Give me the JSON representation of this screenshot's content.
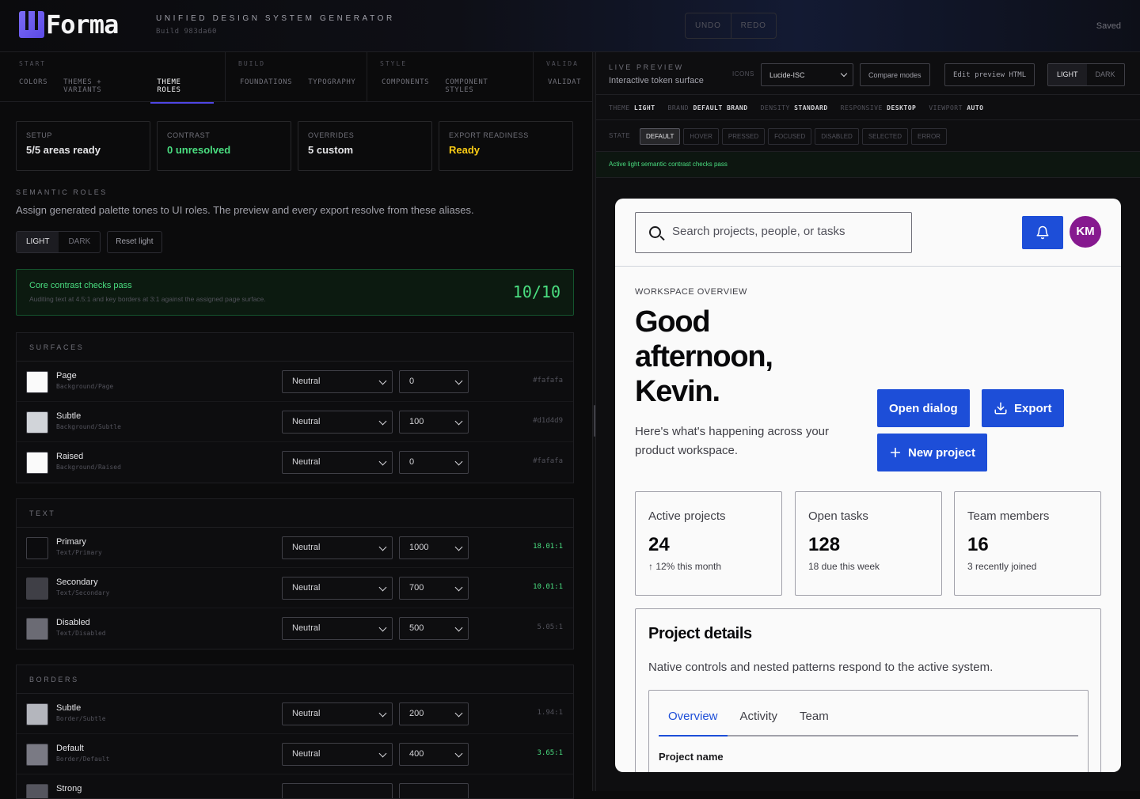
{
  "app": {
    "logo_text": "Forma",
    "subtitle": "UNIFIED DESIGN SYSTEM GENERATOR",
    "build": "Build 983da60",
    "undo": "UNDO",
    "redo": "REDO",
    "saved": "Saved"
  },
  "nav": {
    "groups": [
      {
        "label": "START",
        "items": [
          "COLORS",
          "THEMES + VARIANTS",
          "THEME ROLES"
        ]
      },
      {
        "label": "BUILD",
        "items": [
          "FOUNDATIONS",
          "TYPOGRAPHY"
        ]
      },
      {
        "label": "STYLE",
        "items": [
          "COMPONENTS",
          "COMPONENT STYLES"
        ]
      },
      {
        "label": "VALIDA",
        "items": [
          "VALIDAT"
        ]
      }
    ],
    "active": "THEME ROLES"
  },
  "stats": [
    {
      "label": "SETUP",
      "value": "5/5 areas ready"
    },
    {
      "label": "CONTRAST",
      "value": "0 unresolved"
    },
    {
      "label": "OVERRIDES",
      "value": "5 custom"
    },
    {
      "label": "EXPORT READINESS",
      "value": "Ready"
    }
  ],
  "semantic": {
    "heading": "SEMANTIC ROLES",
    "description": "Assign generated palette tones to UI roles. The preview and every export resolve from these aliases.",
    "mode_light": "LIGHT",
    "mode_dark": "DARK",
    "reset": "Reset light"
  },
  "checks": {
    "title": "Core contrast checks pass",
    "desc": "Auditing text at 4.5:1 and key borders at 3:1 against the assigned page surface.",
    "score": "10/10"
  },
  "groups": {
    "surfaces": {
      "title": "SURFACES",
      "rows": [
        {
          "name": "Page",
          "alias": "Background/Page",
          "palette": "Neutral",
          "tone": "0",
          "value": "#fafafa",
          "swatch": "#fafafa"
        },
        {
          "name": "Subtle",
          "alias": "Background/Subtle",
          "palette": "Neutral",
          "tone": "100",
          "value": "#d1d4d9",
          "swatch": "#d1d4d9"
        },
        {
          "name": "Raised",
          "alias": "Background/Raised",
          "palette": "Neutral",
          "tone": "0",
          "value": "#fafafa",
          "swatch": "#fafafa"
        }
      ]
    },
    "text": {
      "title": "TEXT",
      "rows": [
        {
          "name": "Primary",
          "alias": "Text/Primary",
          "palette": "Neutral",
          "tone": "1000",
          "value": "18.01:1",
          "swatch": "#0c0c0e"
        },
        {
          "name": "Secondary",
          "alias": "Text/Secondary",
          "palette": "Neutral",
          "tone": "700",
          "value": "10.01:1",
          "swatch": "#3f3f46"
        },
        {
          "name": "Disabled",
          "alias": "Text/Disabled",
          "palette": "Neutral",
          "tone": "500",
          "value": "5.05:1",
          "swatch": "#6b6b74"
        }
      ]
    },
    "borders": {
      "title": "BORDERS",
      "rows": [
        {
          "name": "Subtle",
          "alias": "Border/Subtle",
          "palette": "Neutral",
          "tone": "200",
          "value": "1.94:1",
          "swatch": "#b4b6bd"
        },
        {
          "name": "Default",
          "alias": "Border/Default",
          "palette": "Neutral",
          "tone": "400",
          "value": "3.65:1",
          "swatch": "#7a7a84"
        },
        {
          "name": "Strong",
          "alias": "",
          "palette": "",
          "tone": "",
          "value": "",
          "swatch": "#55555e"
        }
      ]
    }
  },
  "preview": {
    "heading": "LIVE PREVIEW",
    "subheading": "Interactive token surface",
    "icons_label": "ICONS",
    "icons_value": "Lucide-ISC",
    "compare": "Compare modes",
    "edit_html": "Edit preview HTML",
    "light": "LIGHT",
    "dark": "DARK",
    "meta": [
      {
        "k": "THEME",
        "v": "LIGHT"
      },
      {
        "k": "BRAND",
        "v": "DEFAULT BRAND"
      },
      {
        "k": "DENSITY",
        "v": "STANDARD"
      },
      {
        "k": "RESPONSIVE",
        "v": "DESKTOP"
      },
      {
        "k": "VIEWPORT",
        "v": "AUTO"
      }
    ],
    "state_label": "STATE",
    "states": [
      "DEFAULT",
      "HOVER",
      "PRESSED",
      "FOCUSED",
      "DISABLED",
      "SELECTED",
      "ERROR"
    ],
    "active_msg": "Active light semantic contrast checks pass"
  },
  "card": {
    "search_placeholder": "Search projects, people, or tasks",
    "avatar": "KM",
    "eyebrow": "WORKSPACE OVERVIEW",
    "greeting": "Good afternoon, Kevin.",
    "lead": "Here's what's happening across your product workspace.",
    "btn_dialog": "Open dialog",
    "btn_export": "Export",
    "btn_new": "New project",
    "kpis": [
      {
        "label": "Active projects",
        "value": "24",
        "detail": "↑ 12% this month"
      },
      {
        "label": "Open tasks",
        "value": "128",
        "detail": "18 due this week"
      },
      {
        "label": "Team members",
        "value": "16",
        "detail": "3 recently joined"
      }
    ],
    "details_title": "Project details",
    "details_desc": "Native controls and nested patterns respond to the active system.",
    "tabs": [
      "Overview",
      "Activity",
      "Team"
    ],
    "field_label": "Project name"
  }
}
